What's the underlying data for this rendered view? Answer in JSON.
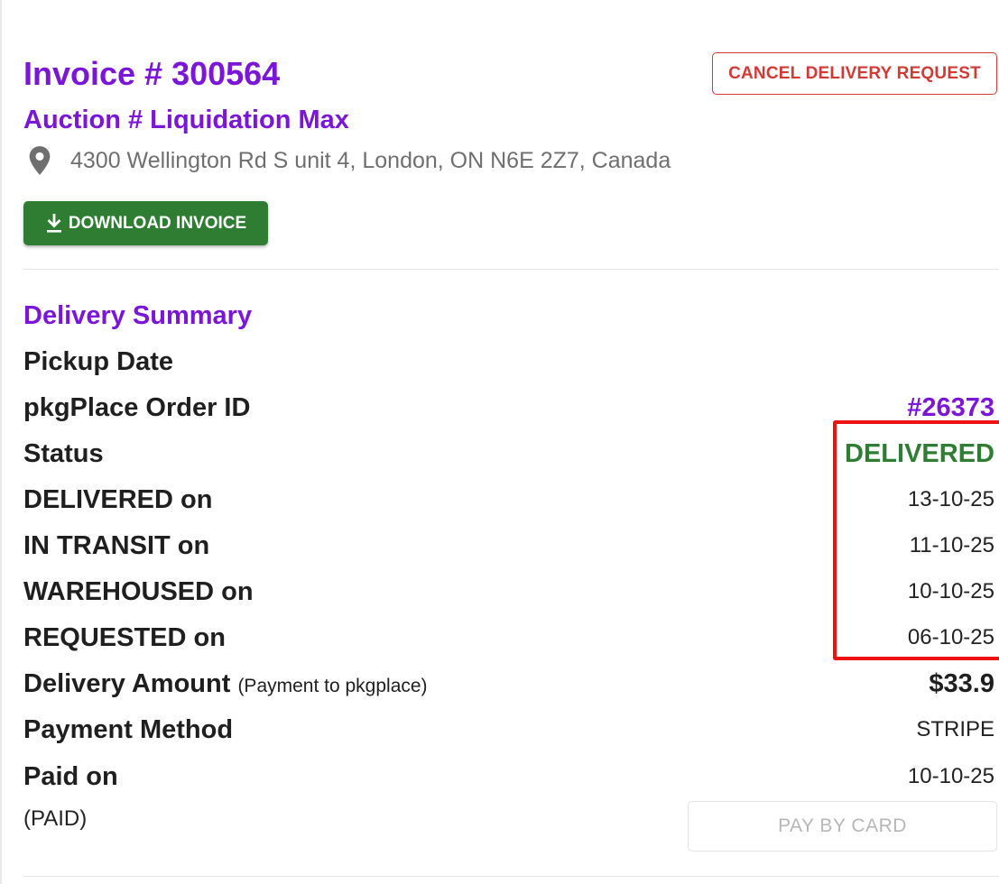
{
  "header": {
    "invoice_title": "Invoice # 300564",
    "auction_title": "Auction # Liquidation Max",
    "address": "4300 Wellington Rd S unit 4, London, ON N6E 2Z7, Canada",
    "cancel_button_label": "CANCEL DELIVERY REQUEST",
    "download_button_label": "DOWNLOAD INVOICE"
  },
  "summary": {
    "title": "Delivery Summary",
    "rows": [
      {
        "label": "Pickup Date",
        "value": ""
      },
      {
        "label": "pkgPlace Order ID",
        "value": "#26373"
      },
      {
        "label": "Status",
        "value": "DELIVERED"
      },
      {
        "label": "DELIVERED on",
        "value": "13-10-25"
      },
      {
        "label": "IN TRANSIT on",
        "value": "11-10-25"
      },
      {
        "label": "WAREHOUSED on",
        "value": "10-10-25"
      },
      {
        "label": "REQUESTED on",
        "value": "06-10-25"
      },
      {
        "label": "Delivery Amount",
        "note": "(Payment to pkgplace)",
        "value": "$33.9"
      },
      {
        "label": "Payment Method",
        "value": "STRIPE"
      },
      {
        "label": "Paid on",
        "value": "10-10-25"
      }
    ],
    "paid_tag": "(PAID)",
    "pay_button_label": "PAY BY CARD"
  },
  "icons": {
    "location": "location-pin-icon",
    "download": "download-icon"
  },
  "colors": {
    "accent_purple": "#7b16d6",
    "success_green": "#2e7d32",
    "danger_red": "#d23a36",
    "highlight_red": "#ee1111"
  }
}
